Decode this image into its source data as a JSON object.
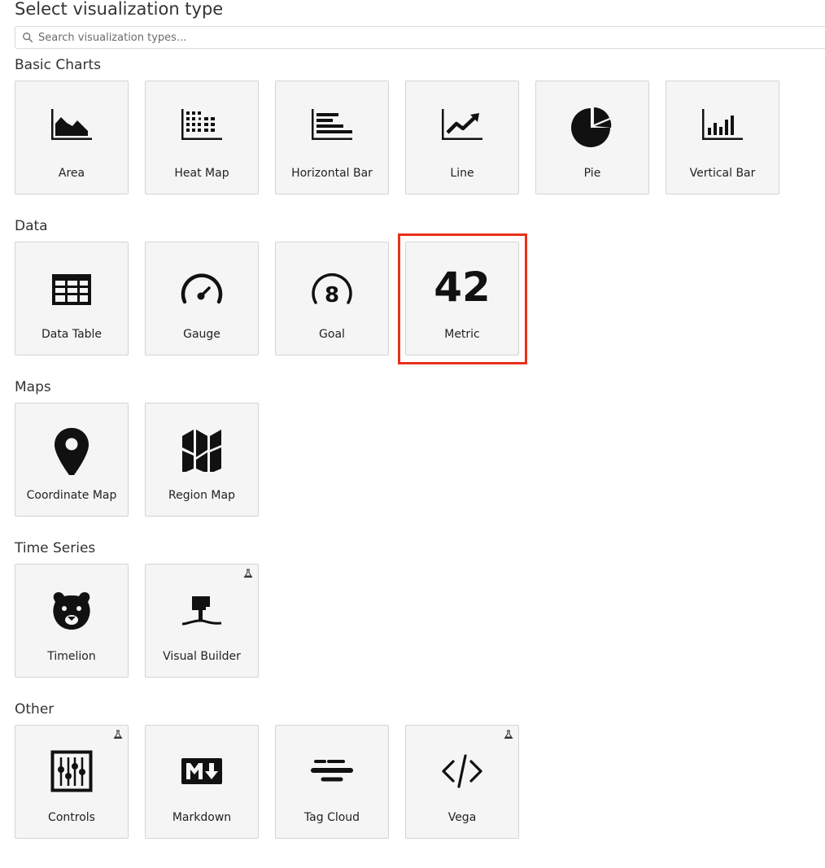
{
  "header": {
    "title": "Select visualization type"
  },
  "search": {
    "placeholder": "Search visualization types..."
  },
  "categories": [
    {
      "title": "Basic Charts",
      "items": [
        {
          "label": "Area",
          "icon": "area-chart-icon"
        },
        {
          "label": "Heat Map",
          "icon": "heat-map-icon"
        },
        {
          "label": "Horizontal Bar",
          "icon": "horizontal-bar-icon"
        },
        {
          "label": "Line",
          "icon": "line-chart-icon"
        },
        {
          "label": "Pie",
          "icon": "pie-chart-icon"
        },
        {
          "label": "Vertical Bar",
          "icon": "vertical-bar-icon"
        }
      ]
    },
    {
      "title": "Data",
      "items": [
        {
          "label": "Data Table",
          "icon": "table-icon"
        },
        {
          "label": "Gauge",
          "icon": "gauge-icon"
        },
        {
          "label": "Goal",
          "icon": "goal-icon",
          "icon_text": "8"
        },
        {
          "label": "Metric",
          "icon": "metric-icon",
          "icon_text": "42",
          "selected": true
        }
      ]
    },
    {
      "title": "Maps",
      "items": [
        {
          "label": "Coordinate Map",
          "icon": "map-pin-icon"
        },
        {
          "label": "Region Map",
          "icon": "region-map-icon"
        }
      ]
    },
    {
      "title": "Time Series",
      "items": [
        {
          "label": "Timelion",
          "icon": "timelion-icon"
        },
        {
          "label": "Visual Builder",
          "icon": "visual-builder-icon",
          "experimental": true
        }
      ]
    },
    {
      "title": "Other",
      "items": [
        {
          "label": "Controls",
          "icon": "controls-icon",
          "experimental": true
        },
        {
          "label": "Markdown",
          "icon": "markdown-icon"
        },
        {
          "label": "Tag Cloud",
          "icon": "tag-cloud-icon"
        },
        {
          "label": "Vega",
          "icon": "code-icon",
          "experimental": true
        }
      ]
    }
  ],
  "colors": {
    "highlight": "#e8301a",
    "card_background": "#f5f5f5",
    "card_border": "#d4d4d4",
    "icon": "#111111"
  }
}
